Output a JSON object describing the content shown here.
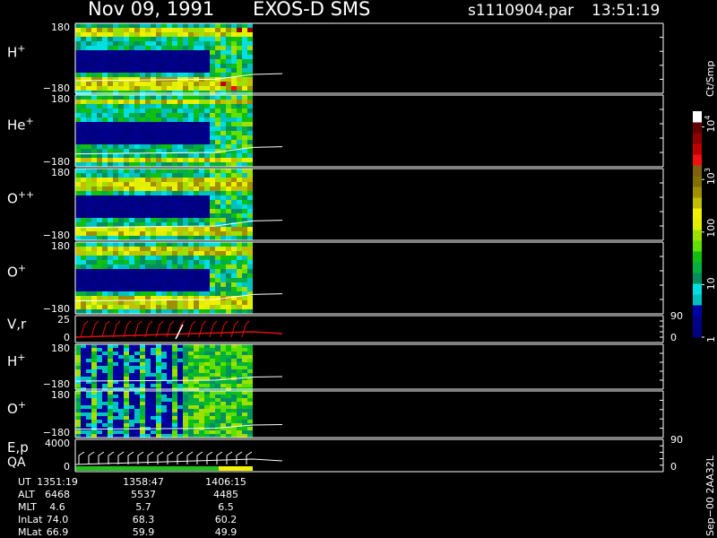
{
  "header": {
    "date": "Nov 09, 1991",
    "instrument": "EXOS-D SMS",
    "file": "s1110904.par",
    "time": "13:51:19"
  },
  "panels": [
    {
      "id": "h-plus-1",
      "label": "H",
      "sup": "+",
      "ytop": "180",
      "ybot": "−180"
    },
    {
      "id": "he-plus",
      "label": "He",
      "sup": "+",
      "ytop": "180",
      "ybot": "−180"
    },
    {
      "id": "o-plus-plus",
      "label": "O",
      "sup": "++",
      "ytop": "180",
      "ybot": "−180"
    },
    {
      "id": "o-plus-1",
      "label": "O",
      "sup": "+",
      "ytop": "180",
      "ybot": "−180"
    },
    {
      "id": "vr",
      "label": "V,r",
      "sup": "",
      "ytop": "25",
      "ybot": "0",
      "rtop": "90",
      "rbot": "0"
    },
    {
      "id": "h-plus-2",
      "label": "H",
      "sup": "+",
      "ytop": "180",
      "ybot": "−180"
    },
    {
      "id": "o-plus-2",
      "label": "O",
      "sup": "+",
      "ytop": "180",
      "ybot": "−180"
    },
    {
      "id": "ep",
      "label": "E,p",
      "sup": "",
      "label2": "QA",
      "ytop": "4000",
      "ybot": "0",
      "rtop": "90",
      "rbot": "0"
    }
  ],
  "colorbar": {
    "unit": "Ct/Smp",
    "ticks": [
      {
        "base": "10",
        "exp": "4",
        "v": 4
      },
      {
        "base": "10",
        "exp": "3",
        "v": 3
      },
      {
        "base": "100",
        "exp": "",
        "v": 2
      },
      {
        "base": "10",
        "exp": "",
        "v": 1
      },
      {
        "base": "1",
        "exp": "",
        "v": 0
      }
    ],
    "colors": [
      "#000080",
      "#00008b",
      "#0000aa",
      "#00c0c0",
      "#00e0e0",
      "#009060",
      "#00b040",
      "#10c010",
      "#60e000",
      "#a0e000",
      "#e0f000",
      "#f0f000",
      "#c0c000",
      "#a09000",
      "#807000",
      "#806010",
      "#f01010",
      "#c00000",
      "#900000",
      "#600000",
      "#ffffff"
    ]
  },
  "footer": {
    "rows": [
      {
        "label": "UT",
        "values": [
          "1351:19",
          "1358:47",
          "1406:15"
        ]
      },
      {
        "label": "ALT",
        "values": [
          "6468",
          "5537",
          "4485"
        ]
      },
      {
        "label": "MLT",
        "values": [
          "4.6",
          "5.7",
          "6.5"
        ]
      },
      {
        "label": "InLat",
        "values": [
          "74.0",
          "68.3",
          "60.2"
        ]
      },
      {
        "label": "MLat",
        "values": [
          "66.9",
          "59.9",
          "49.9"
        ]
      }
    ],
    "side_label": "Sep−00  2AA32L"
  },
  "chart_data": {
    "type": "heatmap",
    "title": "Nov 09, 1991   EXOS-D SMS",
    "x_tick_labels": [
      "1351:19",
      "1358:47",
      "1406:15"
    ],
    "panels": [
      "H+",
      "He+",
      "O++",
      "O+",
      "V,r",
      "H+",
      "O+",
      "E,p QA"
    ],
    "pitch_angle_range": [
      -180,
      180
    ],
    "colorbar_range_counts": [
      1,
      10000
    ],
    "colorbar_scale": "log"
  }
}
